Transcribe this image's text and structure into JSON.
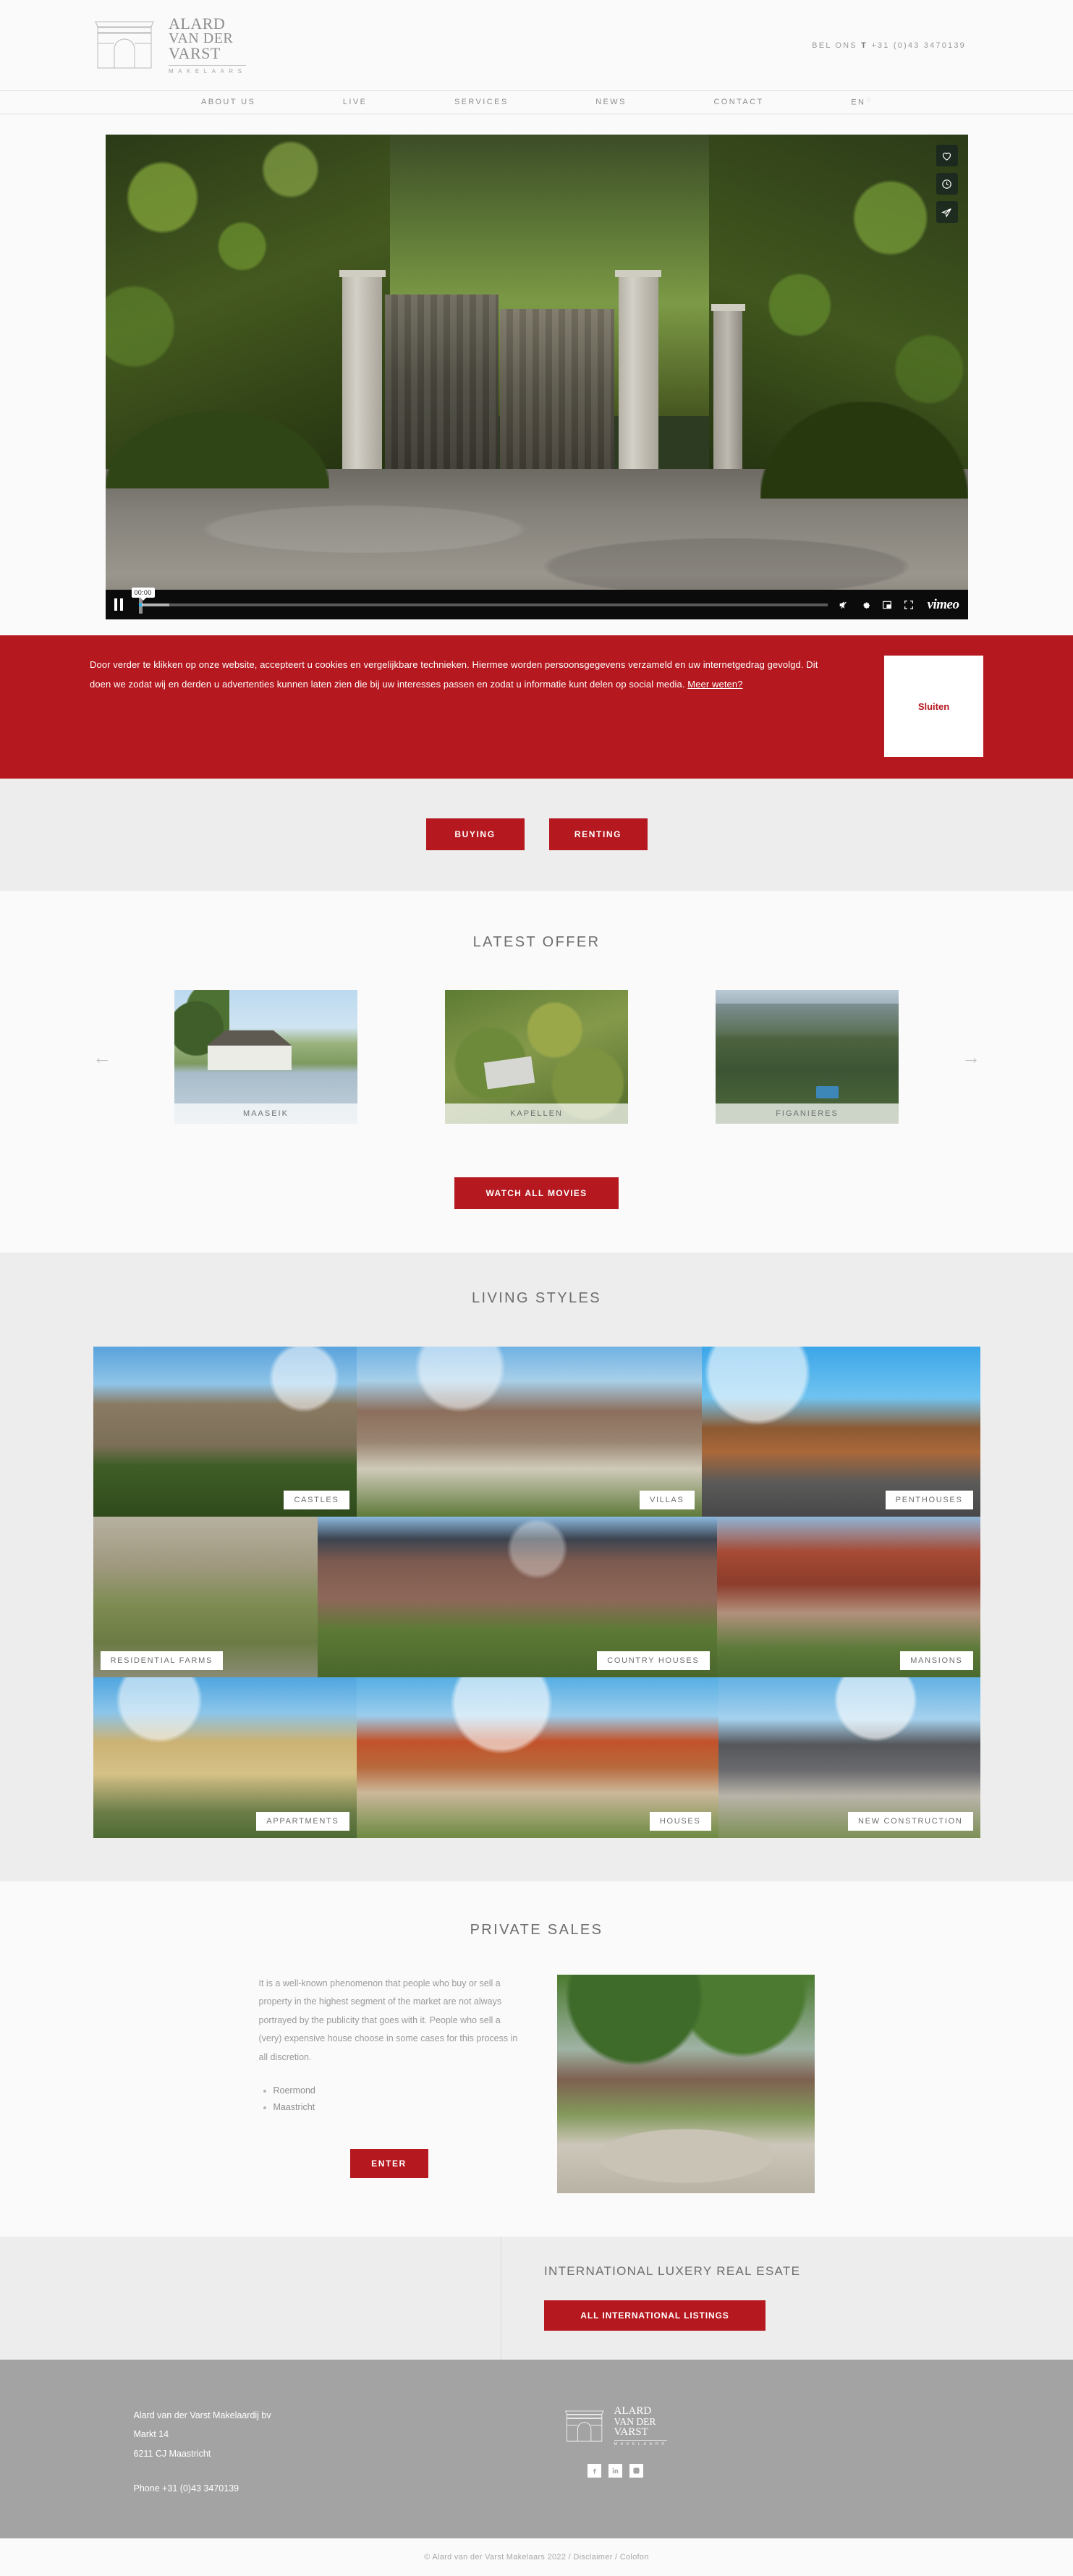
{
  "brand": {
    "line1": "ALARD",
    "line2": "VAN DER",
    "line3": "VARST",
    "sub": "MAKELAARS"
  },
  "header": {
    "phone_prefix": "BEL ONS",
    "phone_t": "T",
    "phone_number": "+31 (0)43 3470139"
  },
  "nav": {
    "items": [
      {
        "label": "ABOUT US"
      },
      {
        "label": "LIVE"
      },
      {
        "label": "SERVICES"
      },
      {
        "label": "NEWS"
      },
      {
        "label": "CONTACT"
      },
      {
        "label": "EN",
        "caret": "□"
      }
    ]
  },
  "video": {
    "time": "00:00",
    "icons": {
      "like": "heart-icon",
      "watch_later": "clock-icon",
      "share": "share-icon",
      "pause": "pause-icon",
      "volume": "volume-muted-icon",
      "settings": "gear-icon",
      "picture_in_picture": "pip-icon",
      "fullscreen": "fullscreen-icon"
    },
    "provider": "vimeo"
  },
  "cookie": {
    "text_1": "Door verder te klikken op onze website, accepteert u cookies en vergelijkbare technieken. Hiermee worden persoonsgegevens verzameld en uw internetgedrag gevolgd. Dit doen we zodat wij en derden u advertenties kunnen laten zien die bij uw interesses passen en zodat u informatie kunt delen op social media. ",
    "link": "Meer weten?",
    "close_label": "Sluiten",
    "bg": "#b5181f"
  },
  "buyrent": {
    "buying": "BUYING",
    "renting": "RENTING"
  },
  "latest": {
    "title": "LATEST OFFER",
    "prev": "←",
    "next": "→",
    "cards": [
      {
        "caption": "MAASEIK"
      },
      {
        "caption": "KAPELLEN"
      },
      {
        "caption": "FIGANIERES"
      }
    ],
    "watch_all": "WATCH ALL MOVIES"
  },
  "living": {
    "title": "LIVING STYLES",
    "tiles": [
      {
        "label": "CASTLES"
      },
      {
        "label": "VILLAS"
      },
      {
        "label": "PENTHOUSES"
      },
      {
        "label": "RESIDENTIAL FARMS"
      },
      {
        "label": "COUNTRY HOUSES"
      },
      {
        "label": "MANSIONS"
      },
      {
        "label": "APPARTMENTS"
      },
      {
        "label": "HOUSES"
      },
      {
        "label": "NEW CONSTRUCTION"
      }
    ]
  },
  "private": {
    "title": "PRIVATE SALES",
    "body": "It is a well-known phenomenon that people who buy or sell a property in the highest segment of the market are not always portrayed by the publicity that goes with it. People who sell a (very) expensive house choose in some cases for this process in all discretion.",
    "list": [
      {
        "label": "Roermond"
      },
      {
        "label": "Maastricht"
      }
    ],
    "enter": "ENTER"
  },
  "international": {
    "title": "INTERNATIONAL LUXERY REAL ESATE",
    "button": "ALL INTERNATIONAL LISTINGS"
  },
  "footer": {
    "company": "Alard van der Varst Makelaardij bv",
    "street": "Markt 14",
    "city": "6211 CJ Maastricht",
    "phone": "Phone +31 (0)43 3470139",
    "socials": [
      {
        "name": "facebook-icon"
      },
      {
        "name": "linkedin-icon"
      },
      {
        "name": "instagram-icon"
      }
    ],
    "copyright": "© Alard van der Varst Makelaars 2022 / Disclaimer / Colofon"
  },
  "colors": {
    "accent": "#b5181f",
    "footer_bg": "#a3a3a3",
    "band_bg": "#ededed",
    "page_bg": "#fafafa"
  }
}
